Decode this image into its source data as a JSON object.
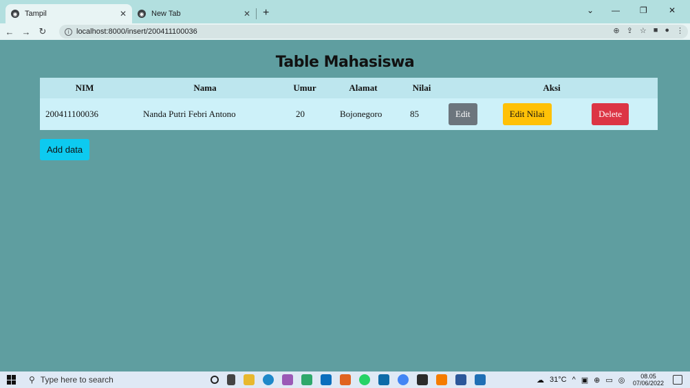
{
  "browser": {
    "tabs": [
      {
        "title": "Tampil",
        "active": true
      },
      {
        "title": "New Tab",
        "active": false
      }
    ],
    "url": "localhost:8000/insert/200411100036"
  },
  "page": {
    "title": "Table Mahasiswa",
    "table": {
      "headers": [
        "NIM",
        "Nama",
        "Umur",
        "Alamat",
        "Nilai",
        "Aksi"
      ],
      "rows": [
        {
          "nim": "200411100036",
          "nama": "Nanda Putri Febri Antono",
          "umur": "20",
          "alamat": "Bojonegoro",
          "nilai": "85"
        }
      ],
      "actions": {
        "edit": "Edit",
        "edit_nilai": "Edit Nilai",
        "delete": "Delete"
      }
    },
    "add_button": "Add data"
  },
  "taskbar": {
    "search_placeholder": "Type here to search",
    "weather": "31°C",
    "time": "08.05",
    "date": "07/06/2022"
  },
  "colors": {
    "background": "#5f9ea0",
    "header_row": "#bde6ee",
    "data_row": "#cdf1f9",
    "edit": "#6c757d",
    "edit_nilai": "#ffc107",
    "delete": "#dc3545",
    "add": "#0dcaf0"
  }
}
